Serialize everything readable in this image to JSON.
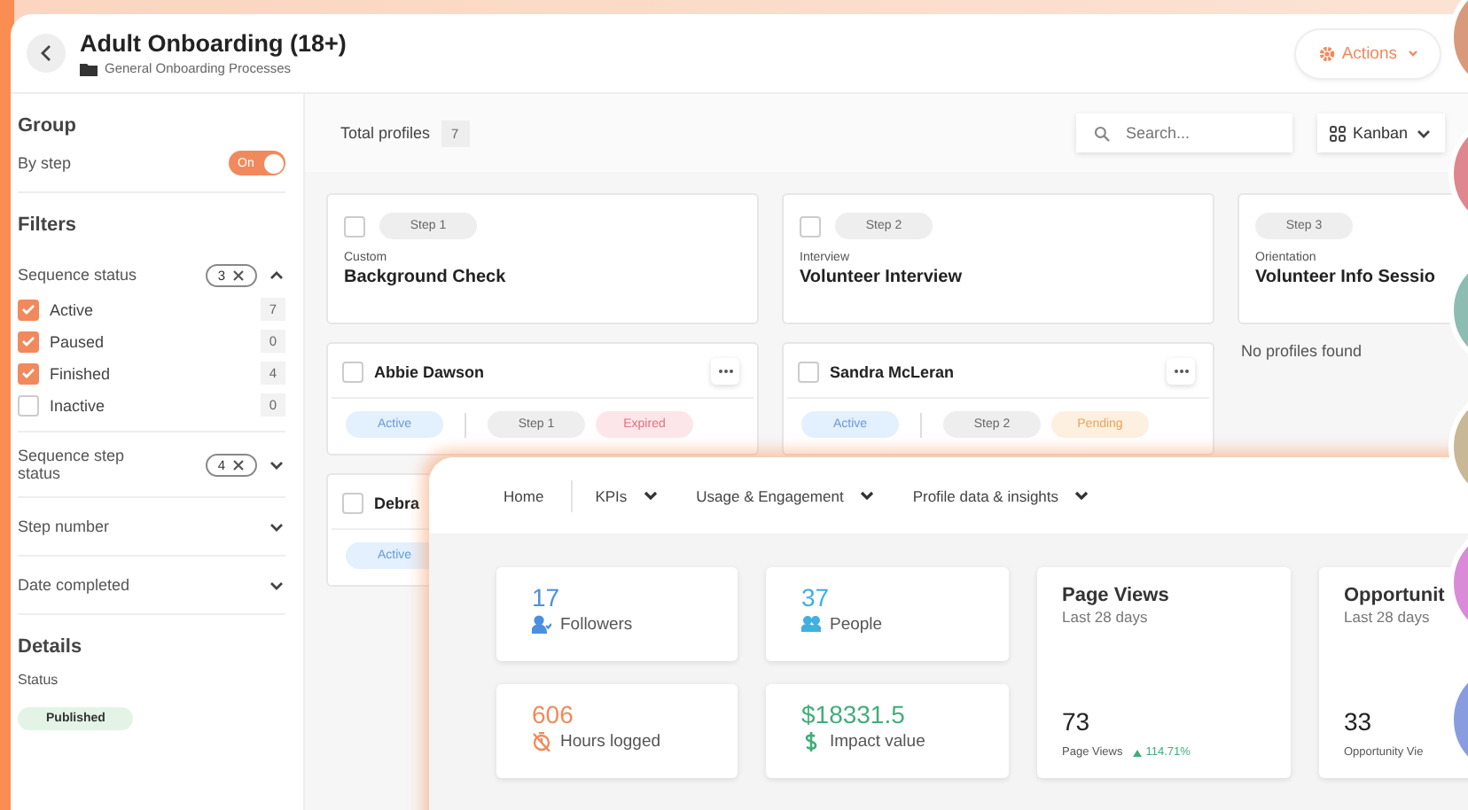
{
  "page_header": {
    "title": "Adult Onboarding (18+)",
    "folder": "General Onboarding Processes",
    "actions_button": "Actions"
  },
  "sidebar": {
    "group": {
      "heading": "Group",
      "by_step_label": "By step",
      "toggle": {
        "label": "On",
        "on": true
      }
    },
    "filters": {
      "heading": "Filters",
      "sections": [
        {
          "label": "Sequence status",
          "count": "3",
          "expanded": true,
          "options": [
            {
              "label": "Active",
              "checked": true,
              "count": "7"
            },
            {
              "label": "Paused",
              "checked": true,
              "count": "0"
            },
            {
              "label": "Finished",
              "checked": true,
              "count": "4"
            },
            {
              "label": "Inactive",
              "checked": false,
              "count": "0"
            }
          ]
        },
        {
          "label": "Sequence step status",
          "count": "4",
          "expanded": false
        },
        {
          "label": "Step number",
          "expanded": false
        },
        {
          "label": "Date completed",
          "expanded": false
        }
      ]
    },
    "details": {
      "heading": "Details",
      "status_label": "Status",
      "status_badge": "Published"
    }
  },
  "toolbar": {
    "total_label": "Total profiles",
    "total_count": "7",
    "search": {
      "placeholder": "Search..."
    },
    "view_button": "Kanban"
  },
  "columns": [
    {
      "step": "Step 1",
      "checked": false,
      "type": "Custom",
      "name": "Background Check",
      "cards": [
        {
          "name": "Abbie Dawson",
          "checked": false,
          "status": "Active",
          "step": "Step 1",
          "step_status": {
            "label": "Expired",
            "kind": "expired"
          }
        },
        {
          "name": "Debra",
          "checked": false,
          "status": "Active"
        }
      ]
    },
    {
      "step": "Step 2",
      "checked": false,
      "type": "Interview",
      "name": "Volunteer Interview",
      "cards": [
        {
          "name": "Sandra McLeran",
          "checked": false,
          "status": "Active",
          "step": "Step 2",
          "step_status": {
            "label": "Pending",
            "kind": "pending"
          }
        }
      ]
    },
    {
      "step": "Step 3",
      "type": "Orientation",
      "name": "Volunteer Info Sessio",
      "empty_text": "No profiles found"
    }
  ],
  "dashboard": {
    "nav": [
      {
        "label": "Home",
        "dropdown": false
      },
      {
        "label": "KPIs",
        "dropdown": true
      },
      {
        "label": "Usage & Engagement",
        "dropdown": true
      },
      {
        "label": "Profile data & insights",
        "dropdown": true
      }
    ],
    "stats": [
      {
        "value": "17",
        "label": "Followers",
        "color": "#4a90e2"
      },
      {
        "value": "37",
        "label": "People",
        "color": "#3fb0e0"
      },
      {
        "value": "606",
        "label": "Hours logged",
        "color": "#f08a5d"
      },
      {
        "value": "$18331.5",
        "label": "Impact value",
        "color": "#3fae7a"
      }
    ],
    "view_cards": [
      {
        "title": "Page Views",
        "period": "Last 28 days",
        "value": "73",
        "label": "Page Views",
        "change": "114.71%"
      },
      {
        "title": "Opportunit",
        "period": "Last 28 days",
        "value": "33",
        "label": "Opportunity Vie"
      }
    ]
  },
  "avatars": [
    {
      "color": "#d99a7c"
    },
    {
      "color": "#e0868f"
    },
    {
      "color": "#8dbdb2"
    },
    {
      "color": "#c9b896"
    },
    {
      "color": "#d98bd8"
    },
    {
      "color": "#8a9ce0"
    }
  ]
}
